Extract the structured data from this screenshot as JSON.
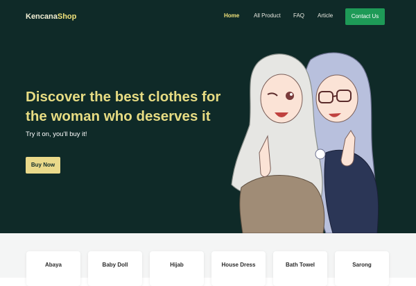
{
  "brand": {
    "part1": "Kencana",
    "part2": "Shop"
  },
  "nav": {
    "links": [
      "Home",
      "All Product",
      "FAQ",
      "Article"
    ],
    "active": "Home",
    "contact_label": "Contact Us"
  },
  "hero": {
    "headline": "Discover the best clothes for the woman who deserves it",
    "subline": "Try it on, you'll buy it!",
    "cta_label": "Buy Now",
    "illustration": "two-girls-in-hijab-illustration"
  },
  "categories": [
    "Abaya",
    "Baby Doll",
    "Hijab",
    "House Dress",
    "Bath Towel",
    "Sarong"
  ],
  "colors": {
    "hero_bg": "#0f2a28",
    "accent_yellow": "#e7dc83",
    "contact_green": "#1e9a57",
    "cta_bg": "#ead98a"
  }
}
